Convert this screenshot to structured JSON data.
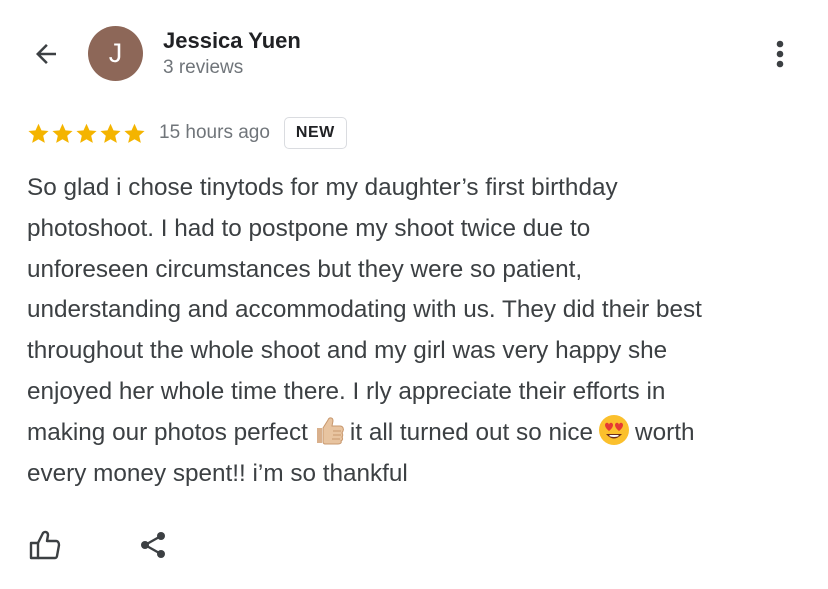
{
  "header": {
    "user_name": "Jessica Yuen",
    "avatar_initial": "J",
    "review_count": "3 reviews",
    "icons": {
      "back": "arrow-back-icon",
      "menu": "more-vert-icon"
    }
  },
  "review": {
    "rating": 5,
    "rating_max": 5,
    "time_ago": "15 hours ago",
    "badge": "NEW",
    "lines": [
      {
        "text": "So glad i chose tinytods for my daughter’s first birthday"
      },
      {
        "text": "photoshoot. I had to postpone my shoot twice due to"
      },
      {
        "text": "unforeseen circumstances but they were so patient,"
      },
      {
        "text": "understanding and accommodating with us. They did their best"
      },
      {
        "text": "throughout the whole shoot and my girl was very happy she"
      },
      {
        "text": "enjoyed her whole time there. I rly appreciate their efforts in"
      },
      {
        "text_a": "making our photos perfect",
        "emoji_a": "thumbs-up-icon",
        "text_b": "it all turned out so nice",
        "emoji_b": "heart-eyes-icon",
        "text_c": "worth"
      },
      {
        "text": "every money spent!! i’m so thankful"
      }
    ]
  },
  "actions": {
    "like_icon": "thumbs-up-outline-icon",
    "share_icon": "share-icon"
  },
  "colors": {
    "star": "#f4b400",
    "avatar_bg": "#8d6758",
    "secondary_text": "#70757a",
    "body_text": "#3c4043"
  }
}
